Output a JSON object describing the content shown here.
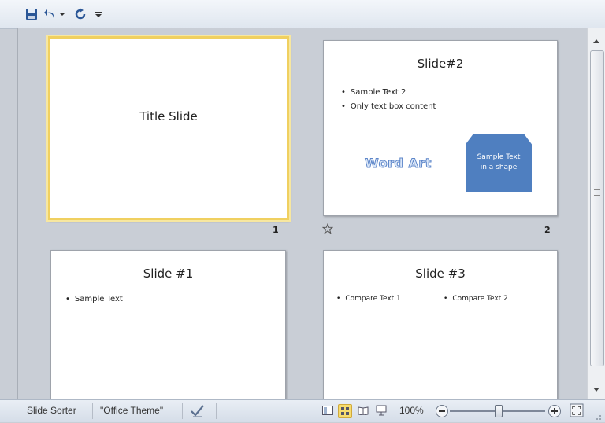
{
  "slides": [
    {
      "number": "1",
      "title": "Title Slide",
      "bullets": []
    },
    {
      "number": "2",
      "title": "Slide#2",
      "bullets": [
        "Sample Text 2",
        "Only text box content"
      ],
      "wordart": "Word Art",
      "shape_lines": [
        "Sample Text",
        "in a shape"
      ],
      "transition_icon": "star-transition-icon"
    },
    {
      "title": "Slide #1",
      "bullets": [
        "Sample Text"
      ]
    },
    {
      "title": "Slide #3",
      "bullets": [
        "Compare Text 1",
        "Compare Text 2"
      ]
    }
  ],
  "status": {
    "view_name": "Slide Sorter",
    "theme": "\"Office Theme\"",
    "zoom": "100%",
    "zoom_level": 0.5
  },
  "colors": {
    "selection": "#f0d060",
    "shape": "#4f7fc0",
    "accent": "#2b5797"
  }
}
